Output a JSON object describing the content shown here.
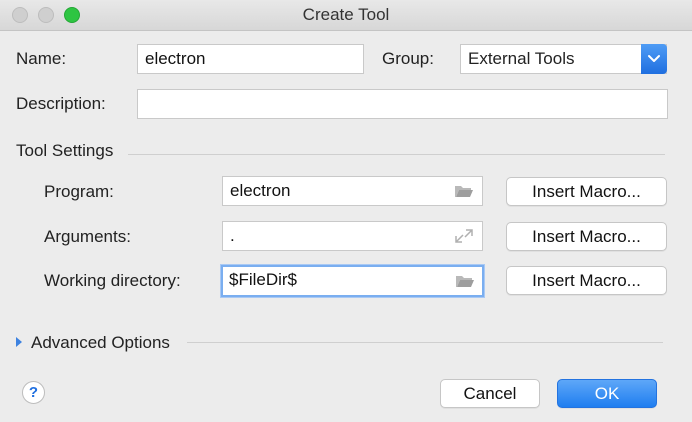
{
  "window": {
    "title": "Create Tool"
  },
  "form": {
    "name_label": "Name:",
    "name_value": "electron",
    "group_label": "Group:",
    "group_value": "External Tools",
    "description_label": "Description:",
    "description_value": ""
  },
  "tool_settings": {
    "section_label": "Tool Settings",
    "program_label": "Program:",
    "program_value": "electron",
    "arguments_label": "Arguments:",
    "arguments_value": ".",
    "working_dir_label": "Working directory:",
    "working_dir_value": "$FileDir$",
    "insert_macro_label": "Insert Macro..."
  },
  "advanced": {
    "label": "Advanced Options"
  },
  "footer": {
    "help_label": "?",
    "cancel_label": "Cancel",
    "ok_label": "OK"
  },
  "icons": {
    "folder": "folder-icon",
    "expand": "expand-icon",
    "chevron": "chevron-down-icon"
  },
  "colors": {
    "accent": "#1f7ef0",
    "focus": "#7aaef0"
  }
}
